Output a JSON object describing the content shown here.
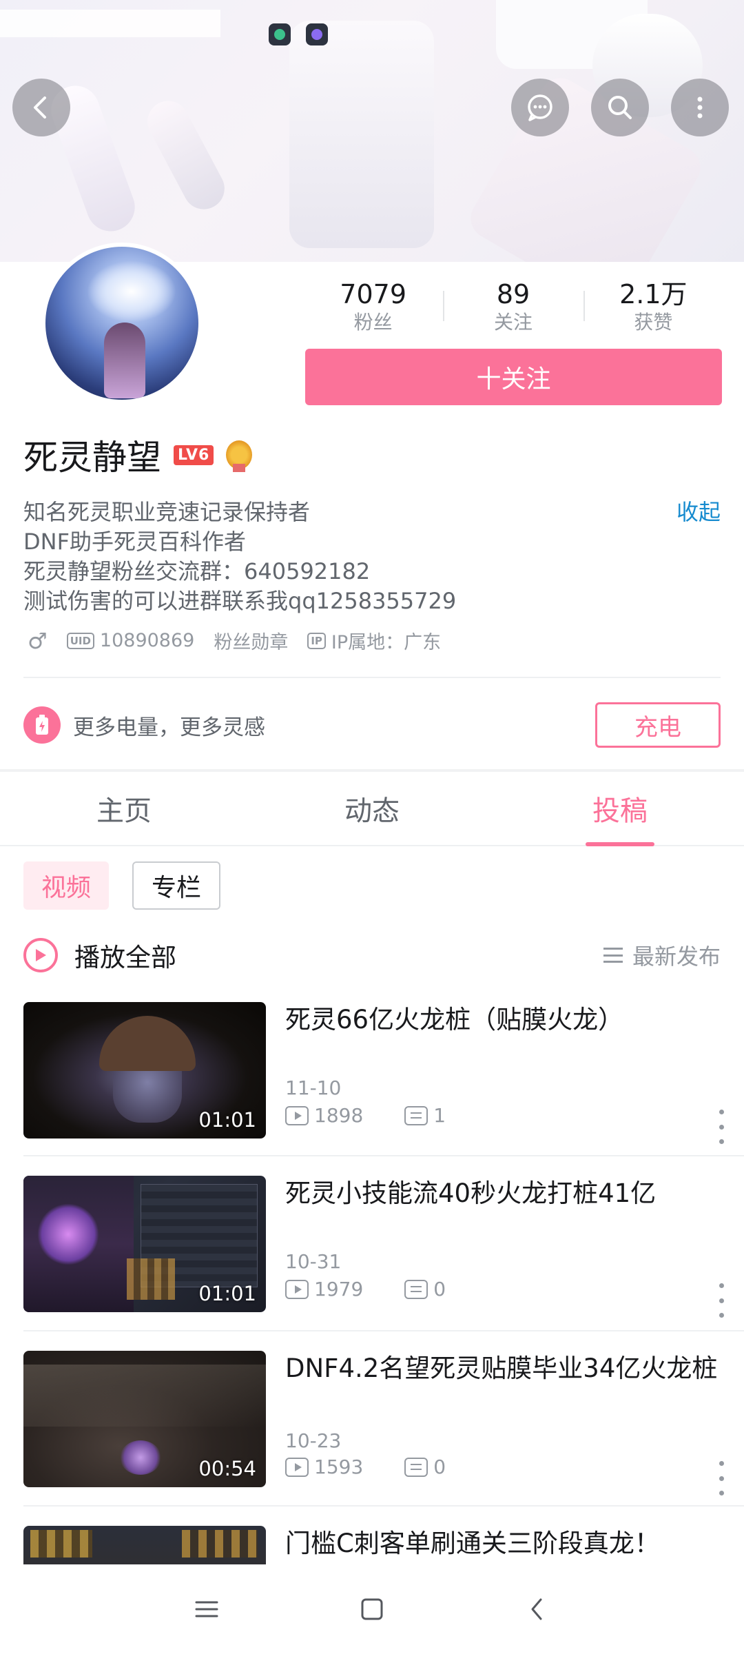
{
  "header": {
    "back_icon": "chevron-left-icon",
    "message_icon": "chat-bubble-icon",
    "search_icon": "search-icon",
    "more_icon": "more-vertical-icon"
  },
  "stats": [
    {
      "value": "7079",
      "label": "粉丝"
    },
    {
      "value": "89",
      "label": "关注"
    },
    {
      "value": "2.1万",
      "label": "获赞"
    }
  ],
  "follow_button": "十关注",
  "profile": {
    "name": "死灵静望",
    "level_badge": "LV6",
    "bio_lines": [
      "知名死灵职业竞速记录保持者",
      "DNF助手死灵百科作者",
      "死灵静望粉丝交流群：640592182",
      "测试伤害的可以进群联系我qq1258355729"
    ],
    "collapse_label": "收起",
    "gender_symbol": "♂",
    "uid_badge": "UID",
    "uid": "10890869",
    "fan_medal": "粉丝勋章",
    "ip_badge": "IP",
    "ip_location": "IP属地：广东"
  },
  "charge": {
    "text": "更多电量，更多灵感",
    "button": "充电"
  },
  "tabs": [
    {
      "label": "主页",
      "active": false
    },
    {
      "label": "动态",
      "active": false
    },
    {
      "label": "投稿",
      "active": true
    }
  ],
  "chips": [
    {
      "label": "视频",
      "active": true
    },
    {
      "label": "专栏",
      "active": false
    }
  ],
  "play_all": "播放全部",
  "sort_label": "最新发布",
  "videos": [
    {
      "title": "死灵66亿火龙桩（贴膜火龙）",
      "date": "11-10",
      "views": "1898",
      "comments": "1",
      "duration": "01:01"
    },
    {
      "title": "死灵小技能流40秒火龙打桩41亿",
      "date": "10-31",
      "views": "1979",
      "comments": "0",
      "duration": "01:01"
    },
    {
      "title": "DNF4.2名望死灵贴膜毕业34亿火龙桩",
      "date": "10-23",
      "views": "1593",
      "comments": "0",
      "duration": "00:54"
    },
    {
      "title": "门槛C刺客单刷通关三阶段真龙！",
      "date": "",
      "views": "",
      "comments": "",
      "duration": ""
    }
  ],
  "colors": {
    "accent_pink": "#fb7299",
    "link_blue": "#178bcf",
    "text_primary": "#18191c",
    "text_secondary": "#61666d",
    "text_muted": "#9499a0"
  }
}
